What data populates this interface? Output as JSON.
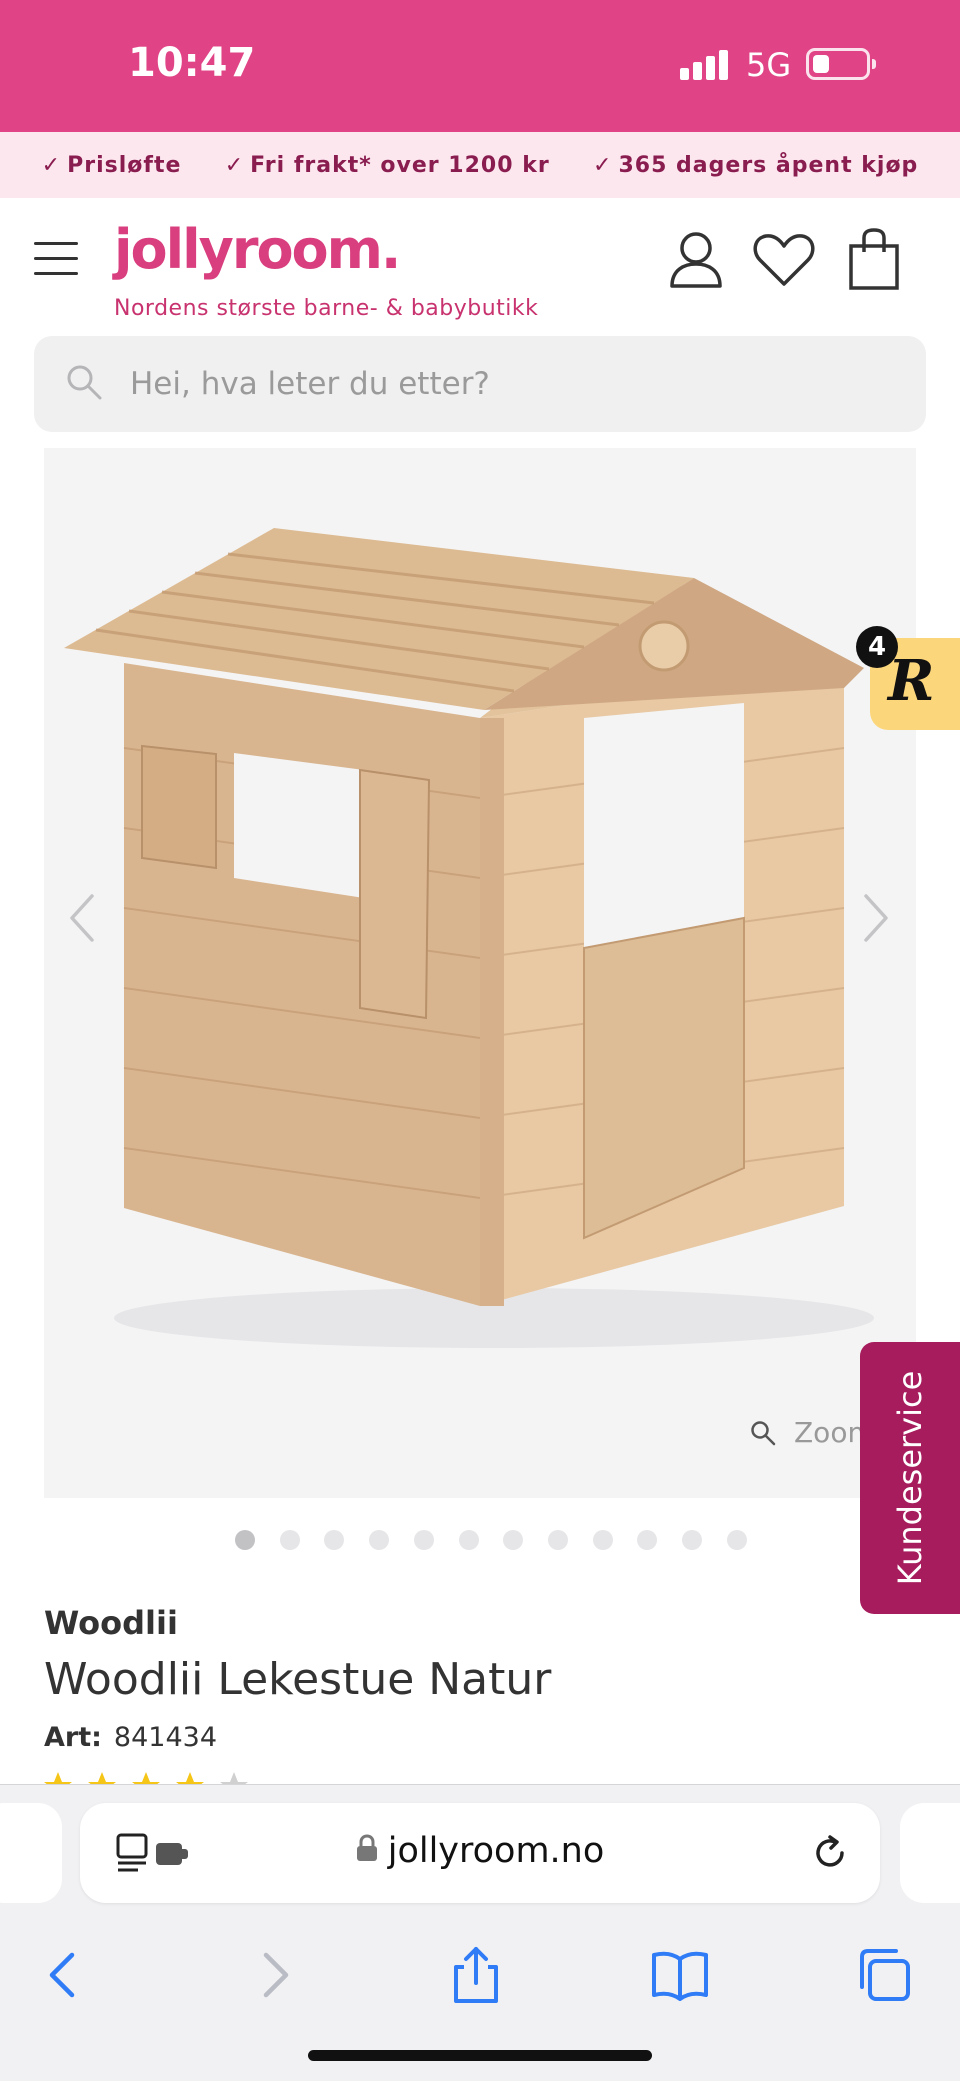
{
  "status_bar": {
    "time": "10:47",
    "network": "5G"
  },
  "usp_bar": {
    "items": [
      {
        "label": "Prisløfte"
      },
      {
        "label": "Fri frakt* over 1200 kr"
      },
      {
        "label": "365 dagers åpent kjøp"
      }
    ]
  },
  "header": {
    "logo": "jollyroom.",
    "tagline": "Nordens største barne- & babybutikk"
  },
  "search": {
    "placeholder": "Hei, hva leter du etter?"
  },
  "gallery": {
    "zoom_label": "Zoom",
    "image_count": 12,
    "active_index": 0
  },
  "badge": {
    "count": "4",
    "letter": "R",
    "color": "#fcd67b"
  },
  "customer_service": {
    "label": "Kundeservice"
  },
  "product": {
    "brand": "Woodlii",
    "name": "Woodlii Lekestue Natur",
    "art_label": "Art:",
    "art_number": "841434"
  },
  "browser": {
    "url": "jollyroom.no"
  },
  "colors": {
    "brand_pink": "#e04486",
    "usp_bg": "#fce7ef",
    "usp_text": "#8a1d4f",
    "kundeservice": "#a61c5c",
    "safari_blue": "#2f7cf6"
  }
}
